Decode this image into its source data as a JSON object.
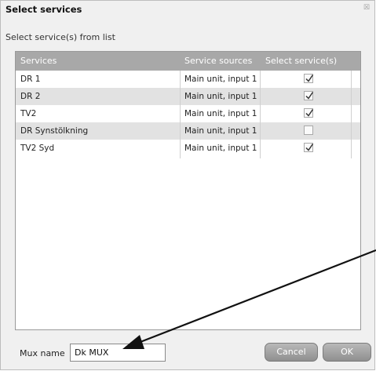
{
  "dialog": {
    "title": "Select services",
    "close_label": "☒",
    "subtitle": "Select service(s) from list"
  },
  "table": {
    "headers": [
      "Services",
      "Service sources",
      "Select service(s)"
    ],
    "rows": [
      {
        "service": "DR 1",
        "source": "Main unit, input 1",
        "selected": true
      },
      {
        "service": "DR 2",
        "source": "Main unit, input 1",
        "selected": true
      },
      {
        "service": "TV2",
        "source": "Main unit, input 1",
        "selected": true
      },
      {
        "service": "DR Synstölkning",
        "source": "Main unit, input 1",
        "selected": false
      },
      {
        "service": "TV2 Syd",
        "source": "Main unit, input 1",
        "selected": true
      }
    ]
  },
  "footer": {
    "mux_label": "Mux name",
    "mux_value": "Dk MUX",
    "cancel_label": "Cancel",
    "ok_label": "OK"
  },
  "colors": {
    "header_bg": "#a8a8a8",
    "alt_row_bg": "#e2e2e2",
    "button_bg": "#9f9f9f",
    "arrow": "#111111"
  }
}
